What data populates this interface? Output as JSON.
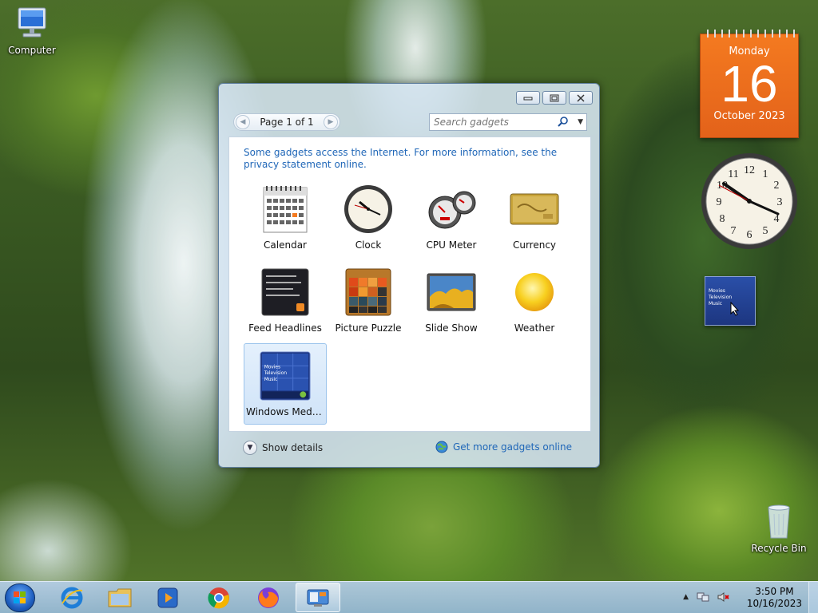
{
  "desktop": {
    "computer_label": "Computer",
    "recycle_label": "Recycle Bin"
  },
  "calendar_gadget": {
    "day_name": "Monday",
    "day_number": "16",
    "month_year": "October 2023"
  },
  "wmc_gadget": {
    "lines": [
      "Movies",
      "Television",
      "Music"
    ]
  },
  "window": {
    "controls": [
      "minimize-icon",
      "restore-icon",
      "close-icon"
    ],
    "pager": {
      "label": "Page 1 of 1"
    },
    "search": {
      "placeholder": "Search gadgets"
    },
    "notice": "Some gadgets access the Internet.  For more information, see the privacy statement online.",
    "gadgets": [
      {
        "name": "Calendar",
        "icon": "calendar-icon"
      },
      {
        "name": "Clock",
        "icon": "clock-icon"
      },
      {
        "name": "CPU Meter",
        "icon": "cpu-meter-icon"
      },
      {
        "name": "Currency",
        "icon": "currency-icon"
      },
      {
        "name": "Feed Headlines",
        "icon": "feed-icon"
      },
      {
        "name": "Picture Puzzle",
        "icon": "puzzle-icon"
      },
      {
        "name": "Slide Show",
        "icon": "slideshow-icon"
      },
      {
        "name": "Weather",
        "icon": "weather-icon"
      },
      {
        "name": "Windows Media...",
        "icon": "media-center-icon",
        "selected": true
      }
    ],
    "show_details": "Show details",
    "get_more": "Get more gadgets online"
  },
  "taskbar": {
    "time": "3:50 PM",
    "date": "10/16/2023",
    "apps": [
      "internet-explorer-icon",
      "file-explorer-icon",
      "media-player-icon",
      "chrome-icon",
      "firefox-icon",
      "gadgets-icon"
    ]
  },
  "colors": {
    "link": "#2067b8",
    "calendar_orange": "#f47a20",
    "selection": "#cfe3f8"
  }
}
